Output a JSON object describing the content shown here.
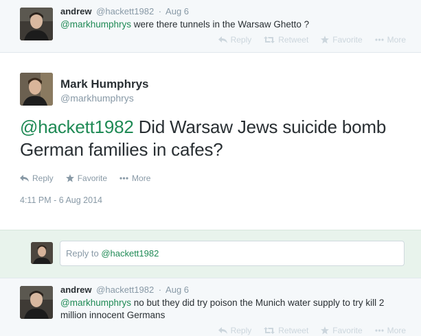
{
  "context_top": {
    "name": "andrew",
    "handle": "@hackett1982",
    "dot": "·",
    "time": "Aug 6",
    "mention": "@markhumphrys",
    "text": " were there tunnels in the Warsaw Ghetto ?",
    "actions": {
      "reply": "Reply",
      "retweet": "Retweet",
      "favorite": "Favorite",
      "more": "More"
    }
  },
  "main_tweet": {
    "name": "Mark Humphrys",
    "handle": "@markhumphrys",
    "mention": "@hackett1982",
    "text": "  Did Warsaw Jews suicide bomb German families in cafes?",
    "actions": {
      "reply": "Reply",
      "favorite": "Favorite",
      "more": "More"
    },
    "timestamp": "4:11 PM - 6 Aug 2014"
  },
  "reply_box": {
    "prefix": "Reply to ",
    "mention": "@hackett1982"
  },
  "context_bottom": {
    "name": "andrew",
    "handle": "@hackett1982",
    "dot": "·",
    "time": "Aug 6",
    "mention": "@markhumphrys",
    "text": " no but they did try poison the Munich water supply to try kill 2 million innocent Germans",
    "actions": {
      "reply": "Reply",
      "retweet": "Retweet",
      "favorite": "Favorite",
      "more": "More"
    }
  },
  "colors": {
    "mention_green": "#1f8a55",
    "muted": "#8899a6",
    "context_bg": "#f5f8fa",
    "reply_bg": "#e8f3ec"
  }
}
